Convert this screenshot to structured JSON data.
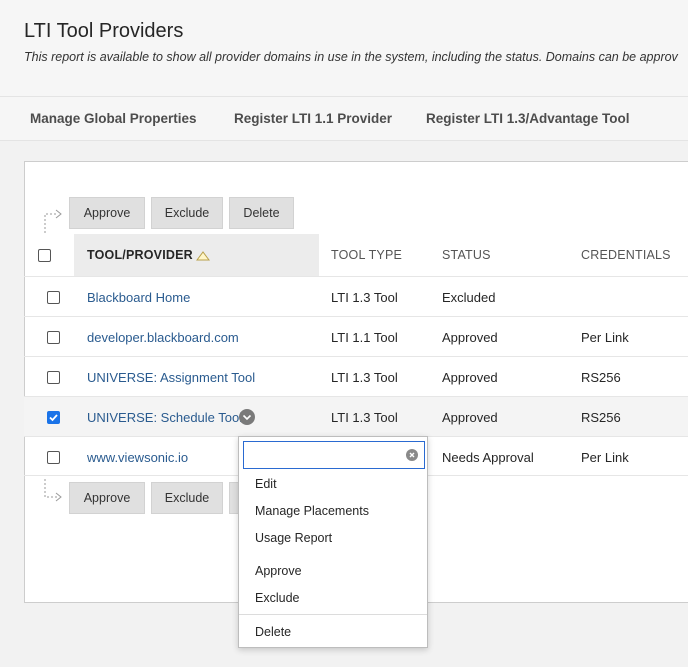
{
  "page": {
    "title": "LTI Tool Providers",
    "description": "This report is available to show all provider domains in use in the system, including the status. Domains can be approv"
  },
  "actions": {
    "manage_global": "Manage Global Properties",
    "register_11": "Register LTI 1.1 Provider",
    "register_13": "Register LTI 1.3/Advantage Tool"
  },
  "bulk": {
    "approve": "Approve",
    "exclude": "Exclude",
    "delete": "Delete"
  },
  "table": {
    "columns": {
      "tool_provider": "TOOL/PROVIDER",
      "tool_type": "TOOL TYPE",
      "status": "STATUS",
      "credentials": "CREDENTIALS"
    },
    "rows": [
      {
        "name": "Blackboard Home",
        "type": "LTI 1.3 Tool",
        "status": "Excluded",
        "credentials": ""
      },
      {
        "name": "developer.blackboard.com",
        "type": "LTI 1.1 Tool",
        "status": "Approved",
        "credentials": "Per Link"
      },
      {
        "name": "UNIVERSE: Assignment Tool",
        "type": "LTI 1.3 Tool",
        "status": "Approved",
        "credentials": "RS256"
      },
      {
        "name": "UNIVERSE: Schedule Tool",
        "type": "LTI 1.3 Tool",
        "status": "Approved",
        "credentials": "RS256",
        "checked": true
      },
      {
        "name": "www.viewsonic.io",
        "type": "",
        "status": "Needs Approval",
        "credentials": "Per Link"
      }
    ]
  },
  "context_menu": {
    "search_placeholder": "",
    "items": {
      "edit": "Edit",
      "manage_placements": "Manage Placements",
      "usage_report": "Usage Report",
      "approve": "Approve",
      "exclude": "Exclude",
      "delete": "Delete"
    }
  },
  "colors": {
    "link": "#2a5b8f",
    "checkbox_checked": "#1a73e8",
    "focus_border": "#2a6ad1"
  }
}
